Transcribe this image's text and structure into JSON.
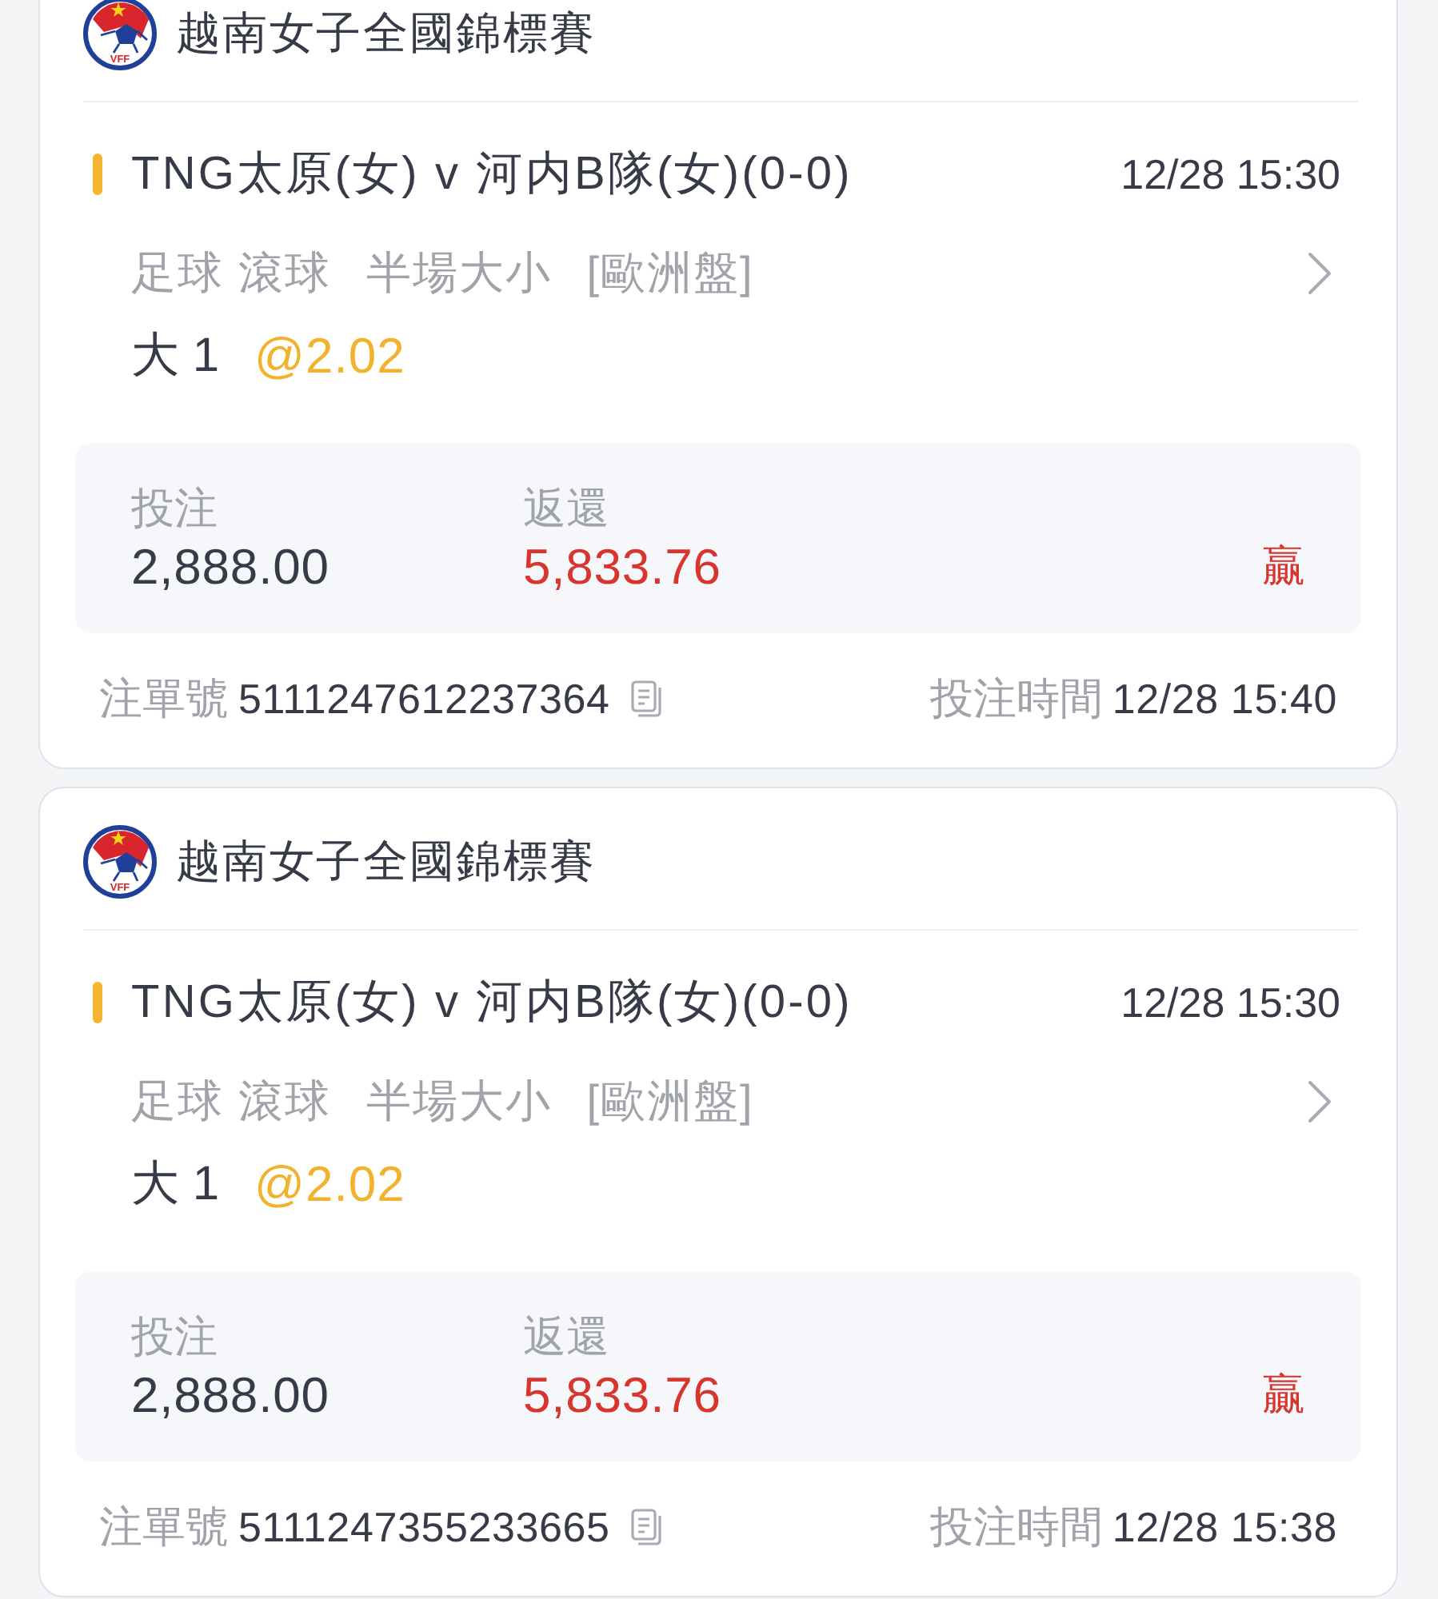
{
  "bets": [
    {
      "league": {
        "name": "越南女子全國錦標賽",
        "logo_text": "VFF"
      },
      "match": {
        "title": "TNG太原(女) v 河内B隊(女)(0-0)",
        "time": "12/28 15:30"
      },
      "market": {
        "sport": "足球 滾球",
        "type": "半場大小",
        "odds_format": "[歐洲盤]"
      },
      "selection": {
        "pick": "大 1",
        "odds": "@2.02"
      },
      "stake": {
        "label": "投注",
        "amount": "2,888.00"
      },
      "payout": {
        "label": "返還",
        "amount": "5,833.76"
      },
      "result": {
        "kind": "win",
        "text": "贏"
      },
      "footer": {
        "id_label": "注單號",
        "id": "5111247612237364",
        "time_label": "投注時間",
        "time": "12/28 15:40"
      }
    },
    {
      "league": {
        "name": "越南女子全國錦標賽",
        "logo_text": "VFF"
      },
      "match": {
        "title": "TNG太原(女) v 河内B隊(女)(0-0)",
        "time": "12/28 15:30"
      },
      "market": {
        "sport": "足球 滾球",
        "type": "半場大小",
        "odds_format": "[歐洲盤]"
      },
      "selection": {
        "pick": "大 1",
        "odds": "@2.02"
      },
      "stake": {
        "label": "投注",
        "amount": "2,888.00"
      },
      "payout": {
        "label": "返還",
        "amount": "5,833.76"
      },
      "result": {
        "kind": "win",
        "text": "贏"
      },
      "footer": {
        "id_label": "注單號",
        "id": "5111247355233665",
        "time_label": "投注時間",
        "time": "12/28 15:38"
      }
    }
  ]
}
